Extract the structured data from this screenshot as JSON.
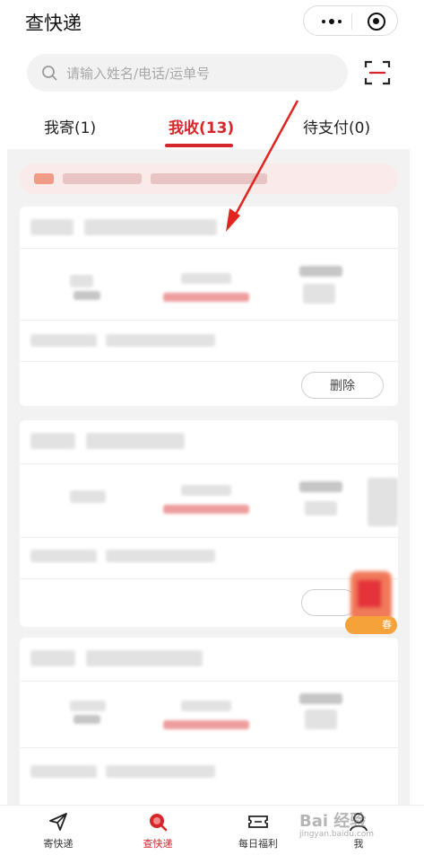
{
  "header": {
    "title": "查快递",
    "more_icon": "more-dots-icon",
    "close_icon": "target-icon"
  },
  "search": {
    "placeholder": "请输入姓名/电话/运单号",
    "scan_icon": "scan-icon"
  },
  "tabs": [
    {
      "label": "我寄(1)",
      "active": false
    },
    {
      "label": "我收(13)",
      "active": true
    },
    {
      "label": "待支付(0)",
      "active": false
    }
  ],
  "cards": [
    {
      "delete_label": "删除"
    },
    {
      "delete_label": ""
    },
    {
      "delete_label": ""
    }
  ],
  "promo": {
    "tag": "春"
  },
  "tabbar": [
    {
      "label": "寄快递",
      "icon": "send-plane-icon",
      "active": false
    },
    {
      "label": "查快递",
      "icon": "search-package-icon",
      "active": true
    },
    {
      "label": "每日福利",
      "icon": "ticket-icon",
      "active": false
    },
    {
      "label": "我",
      "icon": "user-icon",
      "active": false
    }
  ],
  "watermark": {
    "text": "Bai 经验",
    "sub": "jingyan.baidu.com"
  },
  "colors": {
    "accent": "#d7262b",
    "background": "#f2f2f2"
  }
}
